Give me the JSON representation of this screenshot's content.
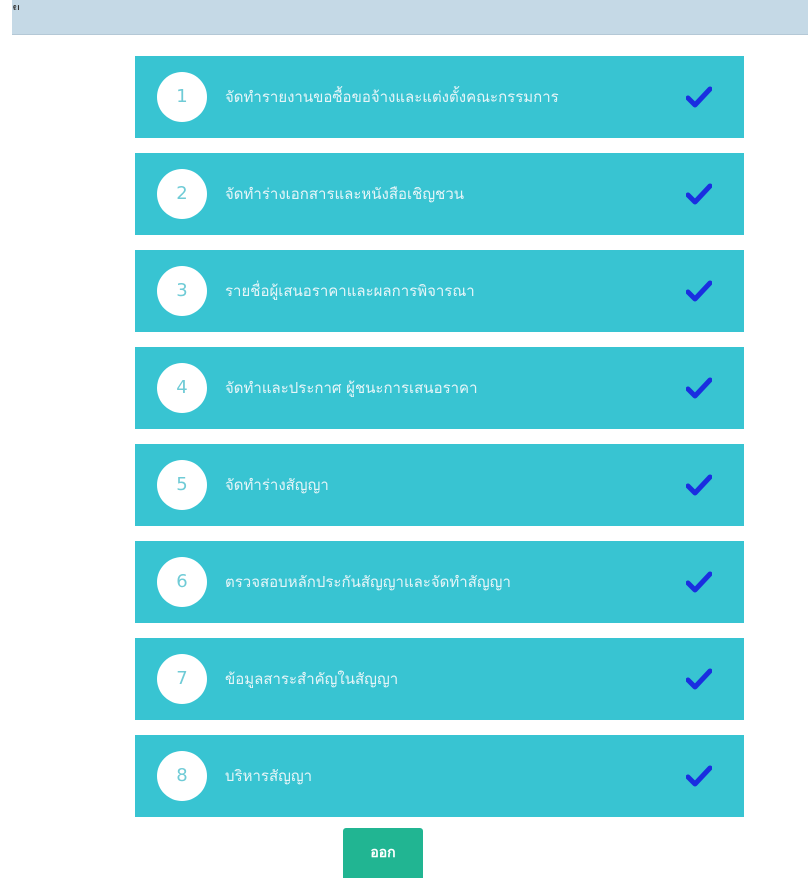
{
  "header": {
    "fragment_text": "ย"
  },
  "steps": [
    {
      "number": "1",
      "label": "จัดทำรายงานขอซื้อขอจ้างและแต่งตั้งคณะกรรมการ",
      "icon": "check-icon"
    },
    {
      "number": "2",
      "label": "จัดทำร่างเอกสารและหนังสือเชิญชวน",
      "icon": "check-icon"
    },
    {
      "number": "3",
      "label": "รายชื่อผู้เสนอราคาและผลการพิจารณา",
      "icon": "check-icon"
    },
    {
      "number": "4",
      "label": "จัดทำและประกาศ ผู้ชนะการเสนอราคา",
      "icon": "check-icon"
    },
    {
      "number": "5",
      "label": "จัดทำร่างสัญญา",
      "icon": "check-icon"
    },
    {
      "number": "6",
      "label": "ตรวจสอบหลักประกันสัญญาและจัดทำสัญญา",
      "icon": "check-icon"
    },
    {
      "number": "7",
      "label": "ข้อมูลสาระสำคัญในสัญญา",
      "icon": "check-icon"
    },
    {
      "number": "8",
      "label": "บริหารสัญญา",
      "icon": "check-icon"
    }
  ],
  "exit_button": {
    "label": "ออก"
  },
  "colors": {
    "step_background": "#38c4d2",
    "check_color": "#1a2ee0",
    "exit_button": "#21b592",
    "topbar": "#c5d9e6"
  }
}
